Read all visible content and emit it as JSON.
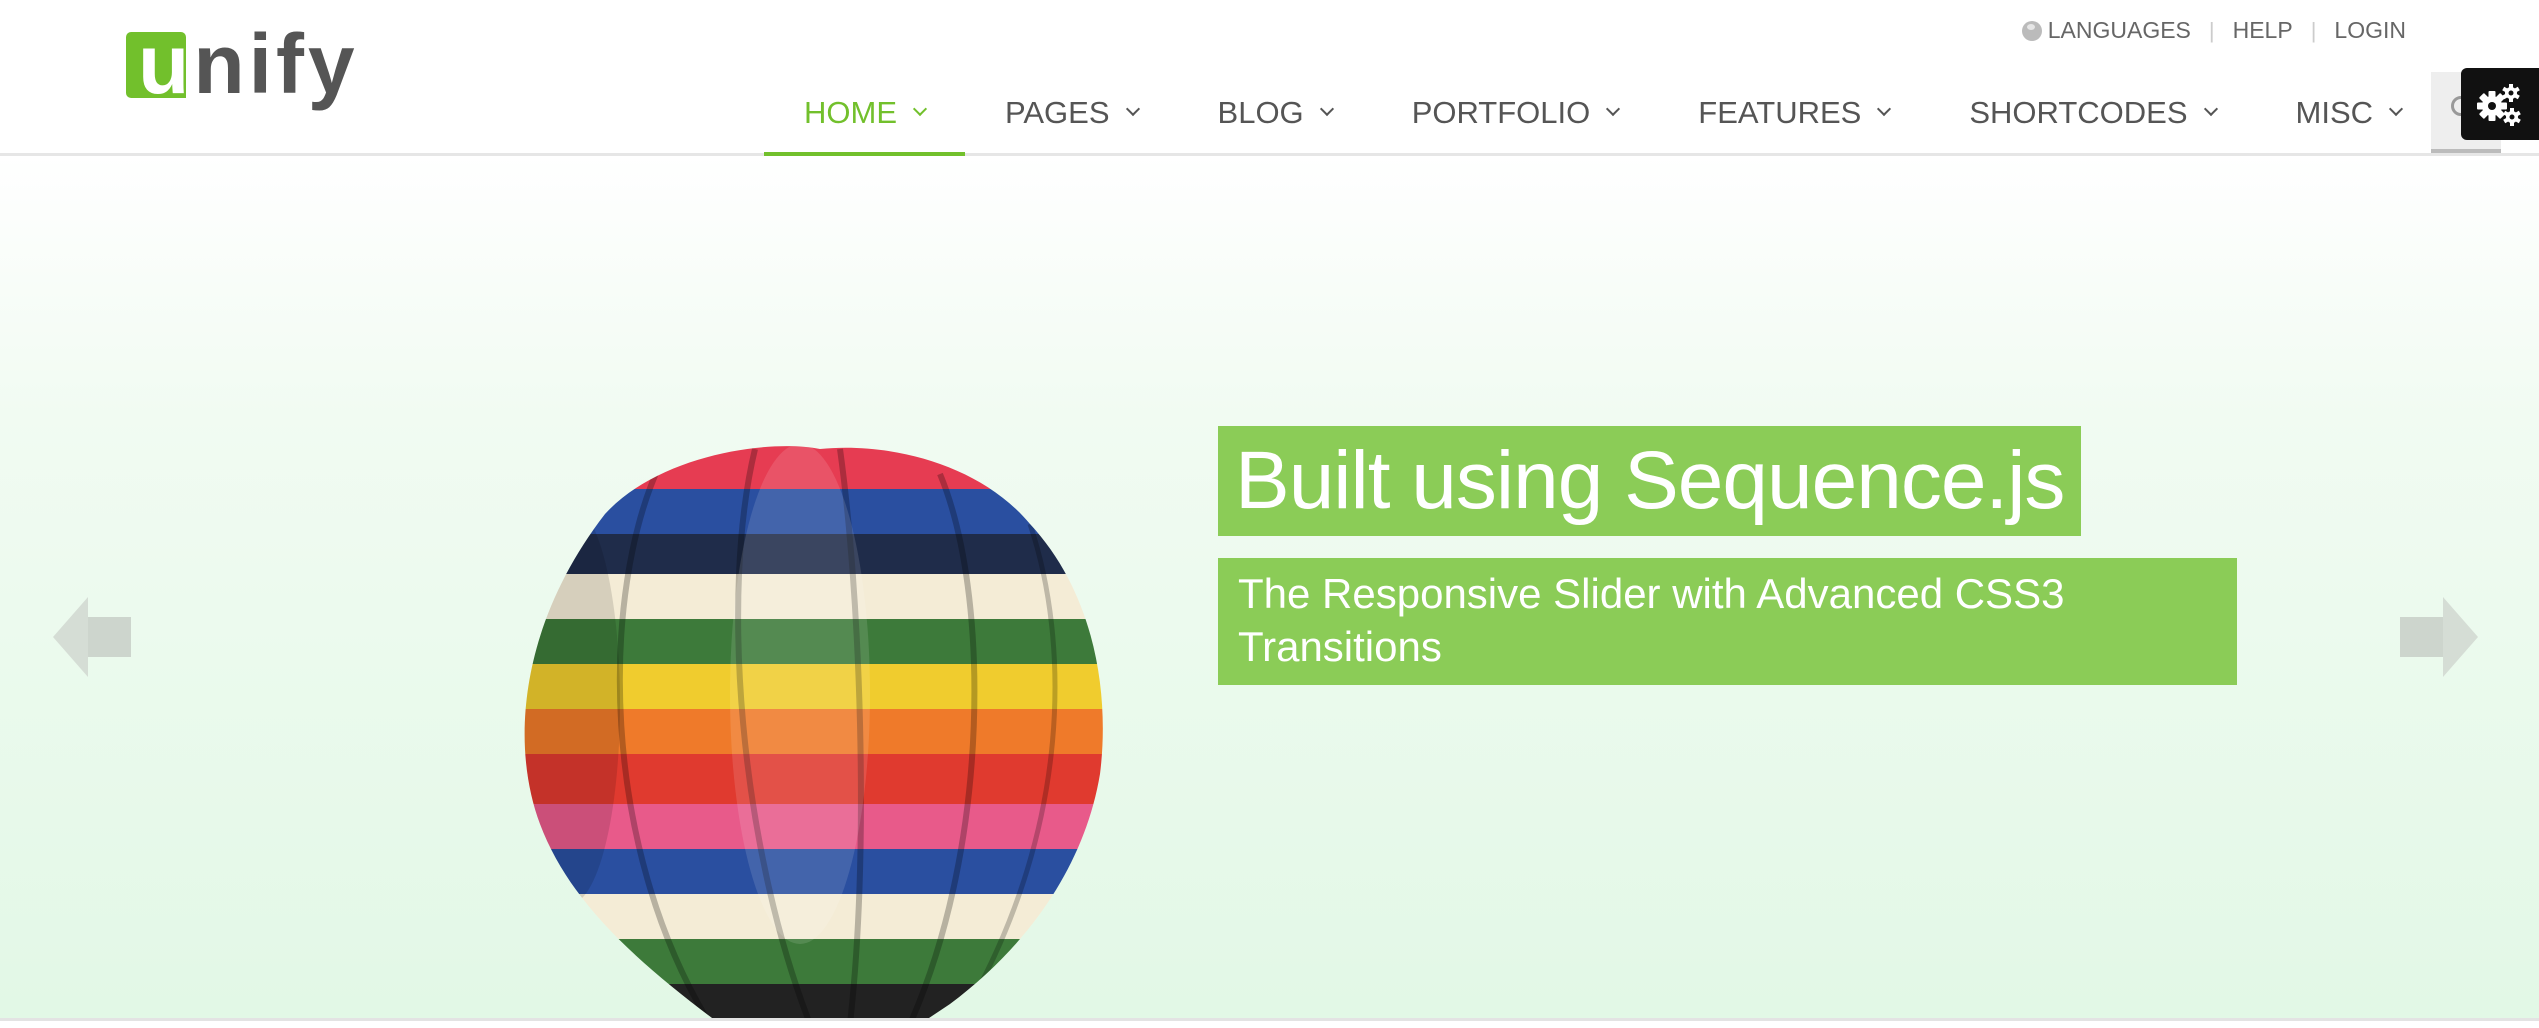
{
  "brand": {
    "logo_text_highlight": "u",
    "logo_text_rest": "nify",
    "accent_color": "#72c02c",
    "caption_bg_color": "#8bcc57"
  },
  "topbar": {
    "languages": "LANGUAGES",
    "help": "HELP",
    "login": "LOGIN"
  },
  "nav": {
    "items": [
      {
        "label": "HOME",
        "active": true
      },
      {
        "label": "PAGES"
      },
      {
        "label": "BLOG"
      },
      {
        "label": "PORTFOLIO"
      },
      {
        "label": "FEATURES"
      },
      {
        "label": "SHORTCODES"
      },
      {
        "label": "MISC"
      }
    ],
    "search_icon": "search-icon"
  },
  "settings": {
    "icon": "gears-icon"
  },
  "slider": {
    "title": "Built using Sequence.js",
    "subtitle": "The Responsive Slider with Advanced CSS3 Transitions",
    "prev_icon": "arrow-left-icon",
    "next_icon": "arrow-right-icon",
    "image": "hot-air-balloon"
  }
}
